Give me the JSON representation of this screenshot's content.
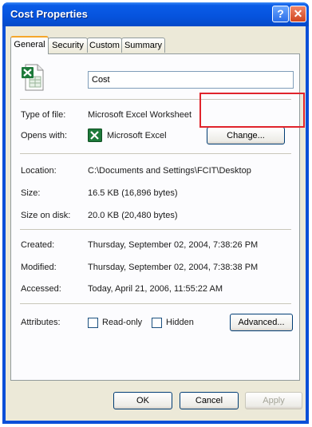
{
  "window": {
    "title": "Cost Properties",
    "help_glyph": "?",
    "close_glyph": "✕"
  },
  "tabs": [
    {
      "label": "General",
      "active": true
    },
    {
      "label": "Security",
      "active": false
    },
    {
      "label": "Custom",
      "active": false
    },
    {
      "label": "Summary",
      "active": false
    }
  ],
  "general": {
    "file_icon": "excel-file-icon",
    "file_name": "Cost",
    "type_label": "Type of file:",
    "type_value": "Microsoft Excel Worksheet",
    "opens_label": "Opens with:",
    "opens_icon": "excel-app-icon",
    "opens_value": "Microsoft Excel",
    "change_button": "Change...",
    "location_label": "Location:",
    "location_value": "C:\\Documents and Settings\\FCIT\\Desktop",
    "size_label": "Size:",
    "size_value": "16.5 KB (16,896 bytes)",
    "size_on_disk_label": "Size on disk:",
    "size_on_disk_value": "20.0 KB (20,480 bytes)",
    "created_label": "Created:",
    "created_value": "Thursday, September 02, 2004, 7:38:26 PM",
    "modified_label": "Modified:",
    "modified_value": "Thursday, September 02, 2004, 7:38:38 PM",
    "accessed_label": "Accessed:",
    "accessed_value": "Today, April 21, 2006, 11:55:22 AM",
    "attributes_label": "Attributes:",
    "readonly_label": "Read-only",
    "readonly_checked": false,
    "hidden_label": "Hidden",
    "hidden_checked": false,
    "advanced_button": "Advanced..."
  },
  "footer": {
    "ok_button": "OK",
    "cancel_button": "Cancel",
    "apply_button": "Apply",
    "apply_enabled": false
  },
  "colors": {
    "titlebar": "#0653dd",
    "highlight": "#e0242c",
    "excel_green": "#1d7a3a"
  }
}
